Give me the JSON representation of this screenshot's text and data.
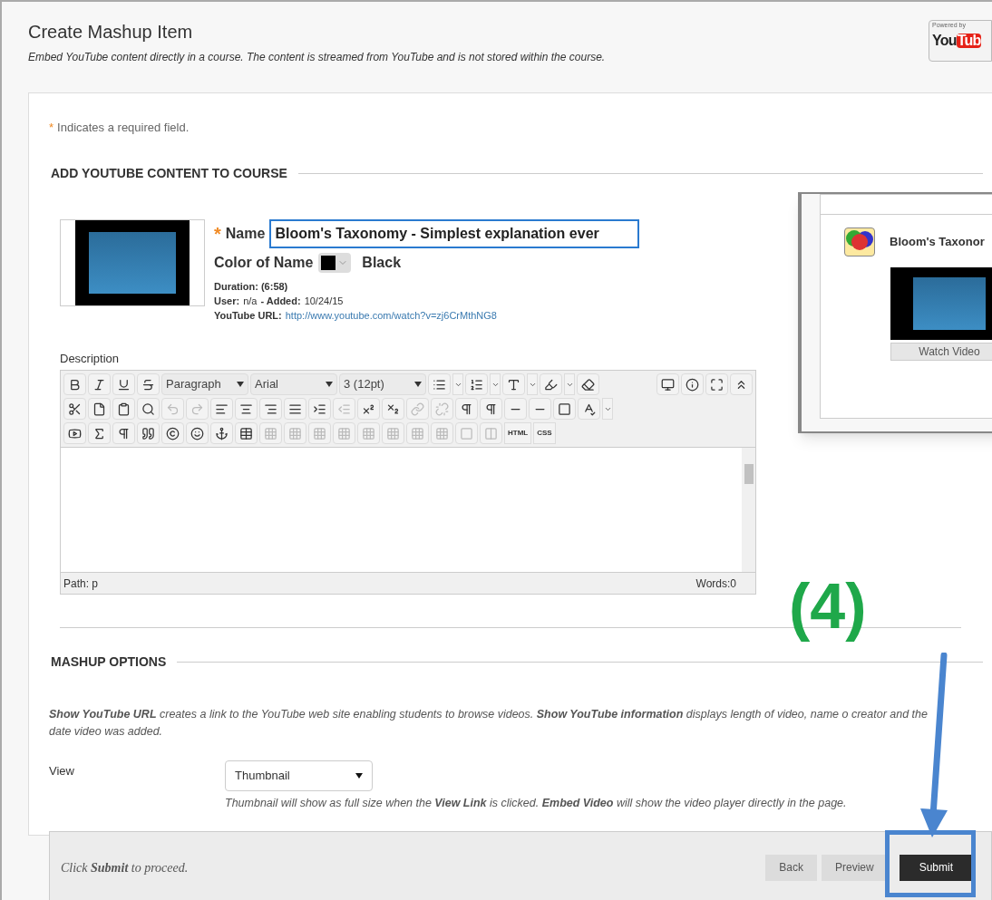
{
  "header": {
    "title": "Create Mashup Item",
    "subtitle": "Embed YouTube content directly in a course. The content is streamed from YouTube and is not stored within the course.",
    "logo": {
      "caption": "Powered by",
      "word_1": "You",
      "word_2": "Tub"
    }
  },
  "required_note": {
    "mark": "*",
    "text": "Indicates a required field."
  },
  "content_section": {
    "heading": "ADD YOUTUBE CONTENT TO COURSE",
    "name_field": {
      "mark": "*",
      "label": "Name",
      "value": "Bloom's Taxonomy - Simplest explanation ever"
    },
    "color_field": {
      "label": "Color of Name",
      "color": "#000000",
      "value": "Black"
    },
    "details": [
      {
        "label": "Duration:",
        "value": "(6:58)",
        "kind": "bold"
      },
      {
        "label": "User:",
        "value": "n/a",
        "kind": "pair",
        "label_2": "- Added:",
        "value_2": "10/24/15"
      },
      {
        "label": "YouTube URL:",
        "value": "http://www.youtube.com/watch?v=zj6CrMthNG8",
        "kind": "link"
      }
    ],
    "editor": {
      "label": "Description",
      "selects": [
        "Paragraph",
        "Arial",
        "3 (12pt)"
      ],
      "text_buttons": [
        "HTML",
        "CSS"
      ],
      "path": "Path: p",
      "words": "Words:0"
    },
    "preview": {
      "title": "Bloom's Taxonor",
      "button": "Watch Video"
    }
  },
  "options_section": {
    "heading": "MASHUP OPTIONS",
    "help": "**Show YouTube URL** creates a link to the YouTube web site enabling students to browse videos. **Show YouTube information** displays length of video, name o creator and the date video was added.",
    "view": {
      "label": "View",
      "value": "Thumbnail",
      "hint": "Thumbnail will show as full size when the **View Link** is clicked. **Embed Video** will show the video player directly in the page."
    }
  },
  "footer": {
    "note": "Click **Submit** to proceed.",
    "buttons": [
      {
        "label": "Back",
        "kind": "secondary"
      },
      {
        "label": "Preview",
        "kind": "secondary"
      },
      {
        "label": "Submit",
        "kind": "primary"
      }
    ]
  },
  "annotation": {
    "label": "(4)"
  }
}
